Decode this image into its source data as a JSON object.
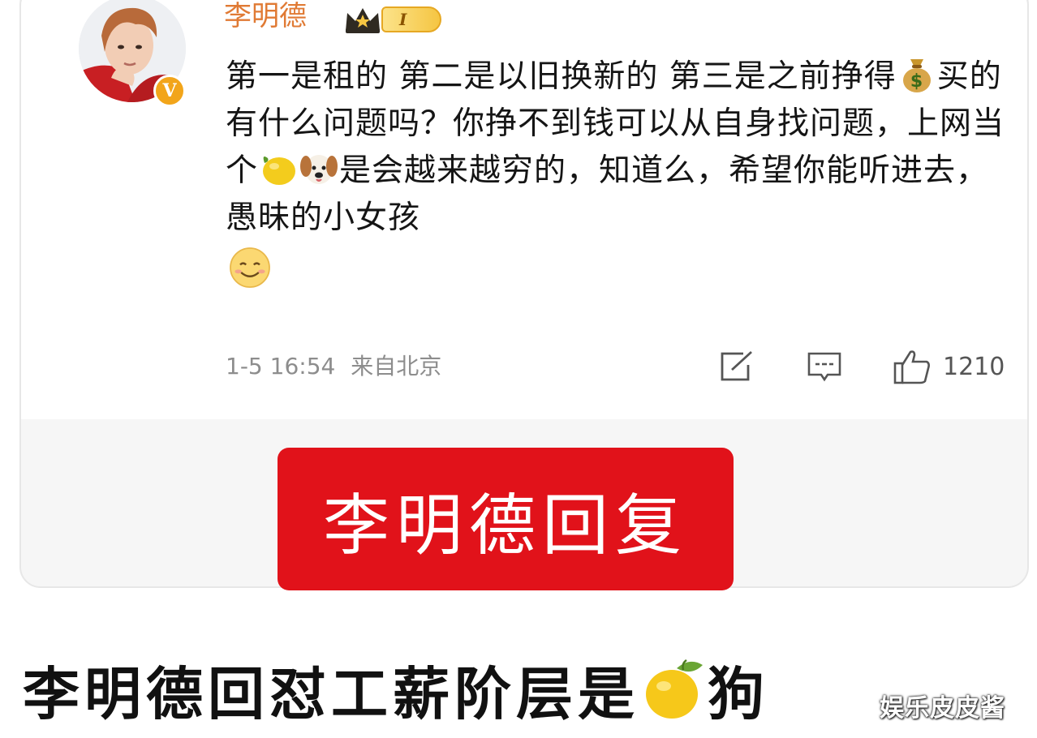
{
  "post": {
    "username": "李明德",
    "level_badge": "I",
    "verified_badge": "V",
    "content_segments": [
      {
        "type": "text",
        "value": "第一是租的 第二是以旧换新的 第三是之前挣得"
      },
      {
        "type": "emoji",
        "name": "money-bag-icon"
      },
      {
        "type": "text",
        "value": "买的 有什么问题吗？你挣不到钱可以从自身找问题，上网当个"
      },
      {
        "type": "emoji",
        "name": "lemon-icon"
      },
      {
        "type": "emoji",
        "name": "dog-face-icon"
      },
      {
        "type": "text",
        "value": "是会越来越穷的，知道么，希望你能听进去，愚昧的小女孩"
      },
      {
        "type": "emoji",
        "name": "smile-icon"
      }
    ],
    "text1": "第一是租的 第二是以旧换新的 第三是之前挣得",
    "text2": "买的 有什么问题吗？你挣不到钱可以从自身找问题，上网当个",
    "text3": "是会越来越穷的，知道么，希望你能听进去，愚昧的小女孩",
    "date": "1-5 16:54",
    "source": "来自北京",
    "actions": {
      "share_icon": "share-icon",
      "comment_icon": "comment-icon",
      "like_icon": "thumbs-up-icon",
      "like_count": "1210"
    }
  },
  "overlay_label": "李明德回复",
  "headline": {
    "before": "李明德回怼工薪阶层是",
    "after": "狗",
    "emoji": "lemon-icon"
  },
  "watermark": "娱乐皮皮酱",
  "colors": {
    "username": "#e07a34",
    "overlay_bg": "#e1121a",
    "meta_text": "#8d8d8d"
  }
}
